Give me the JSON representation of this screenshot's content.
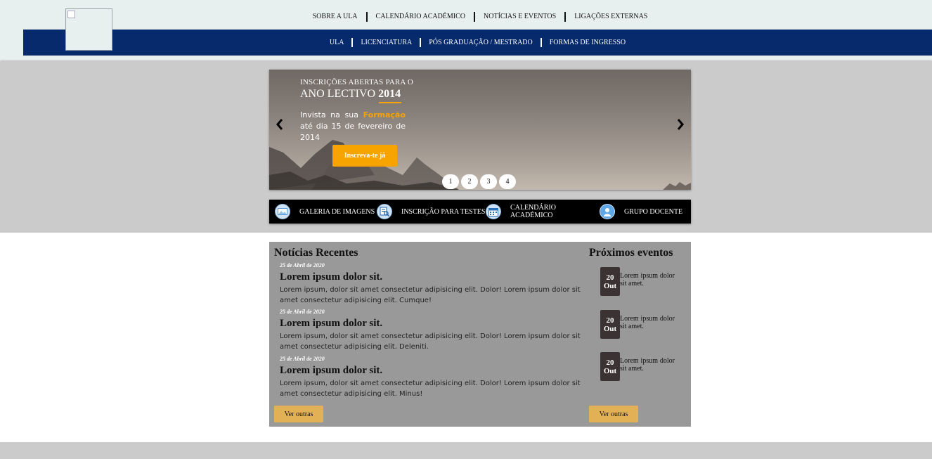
{
  "top_nav": [
    "SOBRE A ULA",
    "CALENDÁRIO ACADÉMICO",
    "NOTÍCIAS E EVENTOS",
    "LIGAÇÕES EXTERNAS"
  ],
  "main_nav": [
    "ULA",
    "LICENCIATURA",
    "PÓS GRADUAÇÃO / MESTRADO",
    "FORMAS DE INGRESSO"
  ],
  "colors": {
    "nav_blue": "#062a6b",
    "accent_orange": "#f7a400",
    "button_gold": "#e2b156"
  },
  "slider": {
    "kicker": "INSCRIÇÕES ABERTAS PARA O",
    "year_prefix": "ANO LECTIVO",
    "year": "2014",
    "desc_before": "Invista na sua",
    "desc_highlight": "Formação",
    "desc_after": "até dia 15 de fevereiro de 2014",
    "cta": "Inscreva-te já",
    "pages": [
      "1",
      "2",
      "3",
      "4"
    ],
    "prev_icon": "chevron-left-icon",
    "next_icon": "chevron-right-icon"
  },
  "quick_links": [
    {
      "label": "GALERIA DE IMAGENS",
      "icon": "image-gallery-icon"
    },
    {
      "label": "INSCRIÇÃO PARA TESTES",
      "icon": "document-search-icon"
    },
    {
      "label": "CALENDÁRIO ACADÉMICO",
      "icon": "calendar-icon"
    },
    {
      "label": "GRUPO DOCENTE",
      "icon": "user-icon"
    }
  ],
  "news": {
    "title": "Notícias Recentes",
    "items": [
      {
        "date": "25 de Abril de 2020",
        "heading": "Lorem ipsum dolor sit.",
        "body": "Lorem ipsum, dolor sit amet consectetur adipisicing elit. Dolor! Lorem ipsum dolor sit amet consectetur adipisicing elit. Cumque!"
      },
      {
        "date": "25 de Abril de 2020",
        "heading": "Lorem ipsum dolor sit.",
        "body": "Lorem ipsum, dolor sit amet consectetur adipisicing elit. Dolor! Lorem ipsum dolor sit amet consectetur adipisicing elit. Deleniti."
      },
      {
        "date": "25 de Abril de 2020",
        "heading": "Lorem ipsum dolor sit.",
        "body": "Lorem ipsum, dolor sit amet consectetur adipisicing elit. Dolor! Lorem ipsum dolor sit amet consectetur adipisicing elit. Minus!"
      }
    ],
    "more": "Ver outras"
  },
  "events": {
    "title": "Próximos eventos",
    "items": [
      {
        "day": "20",
        "month": "Out",
        "text": "Lorem ipsum dolor sit amet."
      },
      {
        "day": "20",
        "month": "Out",
        "text": "Lorem ipsum dolor sit amet."
      },
      {
        "day": "20",
        "month": "Out",
        "text": "Lorem ipsum dolor sit amet."
      }
    ],
    "more": "Ver outras"
  }
}
